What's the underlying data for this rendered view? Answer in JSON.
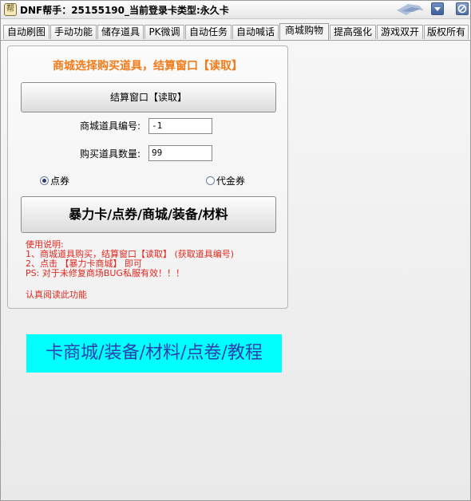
{
  "window": {
    "title": "DNF帮手：25155190_当前登录卡类型:永久卡",
    "icon_glyph": "帮"
  },
  "tabs": [
    {
      "label": "自动刷图"
    },
    {
      "label": "手动功能"
    },
    {
      "label": "储存道具"
    },
    {
      "label": "PK微调"
    },
    {
      "label": "自动任务"
    },
    {
      "label": "自动喊话"
    },
    {
      "label": "商城购物",
      "active": true
    },
    {
      "label": "提高强化"
    },
    {
      "label": "游戏双开"
    },
    {
      "label": "版权所有"
    }
  ],
  "panel": {
    "heading": "商城选择购买道具，结算窗口【读取】",
    "settle_button": "结算窗口【读取】",
    "item_id_label": "商城道具编号:",
    "item_id_value": "-1",
    "quantity_label": "购买道具数量:",
    "quantity_value": "99",
    "radio_points": "点券",
    "radio_coupon": "代金券",
    "selected_currency": "点券",
    "big_button": "暴力卡/点券/商城/装备/材料",
    "instructions": [
      "使用说明:",
      "1、商城道具购买，结算窗口【读取】   (获取道具编号)",
      "2、点击 【暴力卡商城】 即可",
      "PS: 对于未修复商场BUG私服有效！！！"
    ],
    "note": "认真阅读此功能"
  },
  "banner": {
    "text": "卡商城/装备/材料/点卷/教程",
    "background": "#00ffff",
    "color": "#2c3fae"
  },
  "colors": {
    "heading": "#f27b1a",
    "instructions": "#e0281e"
  },
  "icons": {
    "minimize": "chevron-down-icon",
    "close": "no-entry-icon"
  }
}
